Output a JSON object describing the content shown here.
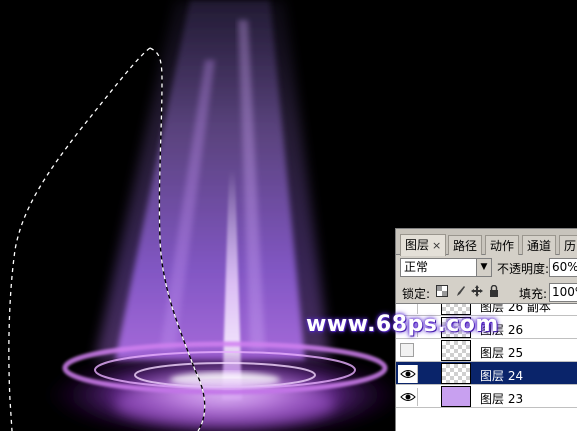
{
  "panel": {
    "tabs": [
      {
        "label": "图层",
        "close": "×"
      },
      {
        "label": "路径"
      },
      {
        "label": "动作"
      },
      {
        "label": "通道"
      },
      {
        "label": "历"
      }
    ],
    "blend_mode": "正常",
    "opacity_label": "不透明度:",
    "opacity_value": "60%",
    "lock_label": "锁定:",
    "fill_label": "填充:",
    "fill_value": "100%",
    "layers": [
      {
        "name": "图层 26 副本",
        "visible": false,
        "selected": false,
        "thumb": "transparent"
      },
      {
        "name": "图层 26",
        "visible": false,
        "selected": false,
        "thumb": "transparent"
      },
      {
        "name": "图层 25",
        "visible": false,
        "selected": false,
        "thumb": "transparent"
      },
      {
        "name": "图层 24",
        "visible": true,
        "selected": true,
        "thumb": "transparent"
      },
      {
        "name": "图层 23",
        "visible": true,
        "selected": false,
        "thumb": "solid"
      }
    ]
  },
  "watermark": "www.68ps.com",
  "colors": {
    "canvas_bg": "#000000",
    "beam": "#9a6ad6",
    "ring": "#c07ae8",
    "selected_layer": "#0a246a",
    "panel_bg": "#d4d0c8",
    "layer_fill_thumb": "#c8a0f0"
  },
  "icons": [
    "eye-icon",
    "lock-transparent-icon",
    "lock-paint-icon",
    "lock-move-icon",
    "lock-all-icon",
    "dropdown-arrow-icon"
  ]
}
